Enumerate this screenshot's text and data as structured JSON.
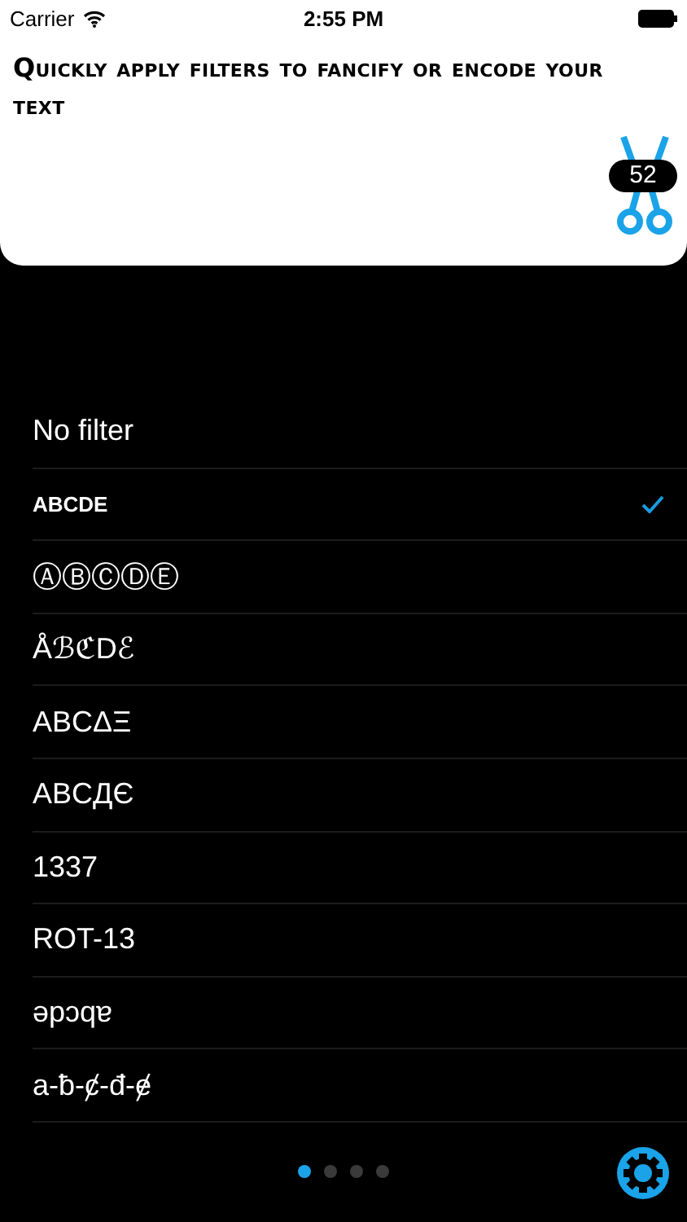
{
  "status_bar": {
    "carrier": "Carrier",
    "time": "2:55 PM"
  },
  "header": {
    "text": "Quickly apply filters to fancify or encode your text",
    "badge": "52"
  },
  "filters": [
    {
      "label": "No filter",
      "kind": "normal",
      "selected": false
    },
    {
      "label": "ABCDE",
      "kind": "small",
      "selected": true
    },
    {
      "label": "ⒶⒷⒸⒹⒺ",
      "kind": "normal",
      "selected": false
    },
    {
      "label": "ÅℬℭDℰ",
      "kind": "normal",
      "selected": false
    },
    {
      "label": "ABCΔΞ",
      "kind": "normal",
      "selected": false
    },
    {
      "label": "ABCДЄ",
      "kind": "normal",
      "selected": false
    },
    {
      "label": "1337",
      "kind": "normal",
      "selected": false
    },
    {
      "label": "ROT-13",
      "kind": "normal",
      "selected": false
    },
    {
      "label": "ǝpɔqɐ",
      "kind": "normal",
      "selected": false
    },
    {
      "label": "a-ƀ-ȼ-đ-ɇ",
      "kind": "normal",
      "selected": false
    }
  ],
  "pages": [
    {
      "selected": true
    },
    {
      "selected": false
    },
    {
      "selected": false
    },
    {
      "selected": false
    }
  ]
}
